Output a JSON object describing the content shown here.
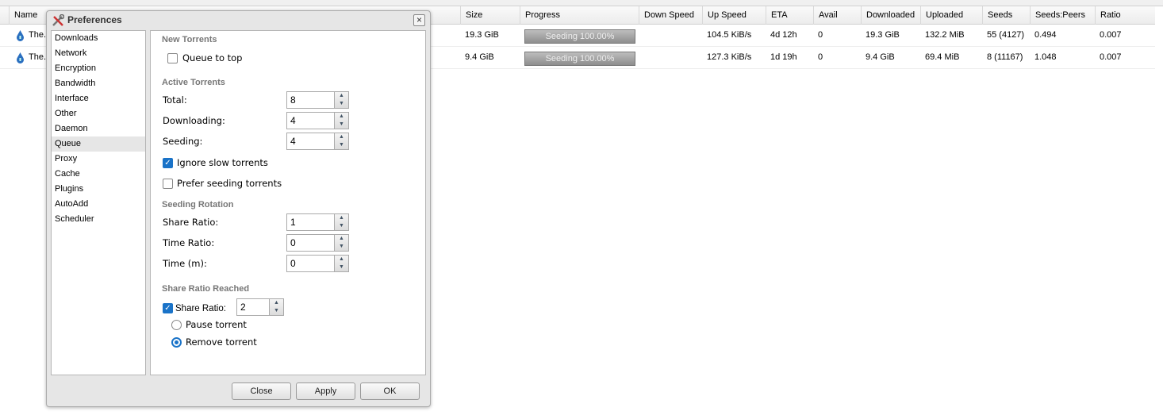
{
  "table": {
    "columns": [
      "Name",
      "Size",
      "Progress",
      "Down Speed",
      "Up Speed",
      "ETA",
      "Avail",
      "Downloaded",
      "Uploaded",
      "Seeds",
      "Seeds:Peers",
      "Ratio"
    ],
    "rows": [
      {
        "name": "The.",
        "size": "19.3 GiB",
        "progress": "Seeding 100.00%",
        "progress_value": 100,
        "down_speed": "",
        "up_speed": "104.5 KiB/s",
        "eta": "4d 12h",
        "avail": "0",
        "downloaded": "19.3 GiB",
        "uploaded": "132.2 MiB",
        "seeds": "55 (4127)",
        "seeds_peers": "0.494",
        "ratio": "0.007"
      },
      {
        "name": "The.",
        "size": "9.4 GiB",
        "progress": "Seeding 100.00%",
        "progress_value": 100,
        "down_speed": "",
        "up_speed": "127.3 KiB/s",
        "eta": "1d 19h",
        "avail": "0",
        "downloaded": "9.4 GiB",
        "uploaded": "69.4 MiB",
        "seeds": "8 (11167)",
        "seeds_peers": "1.048",
        "ratio": "0.007"
      }
    ]
  },
  "dialog": {
    "title": "Preferences",
    "categories": [
      "Downloads",
      "Network",
      "Encryption",
      "Bandwidth",
      "Interface",
      "Other",
      "Daemon",
      "Queue",
      "Proxy",
      "Cache",
      "Plugins",
      "AutoAdd",
      "Scheduler"
    ],
    "selected": "Queue",
    "new_torrents": {
      "heading": "New Torrents",
      "queue_to_top": "Queue to top",
      "queue_to_top_checked": false
    },
    "active": {
      "heading": "Active Torrents",
      "total_label": "Total:",
      "total": "8",
      "downloading_label": "Downloading:",
      "downloading": "4",
      "seeding_label": "Seeding:",
      "seeding": "4",
      "ignore_slow": "Ignore slow torrents",
      "ignore_slow_checked": true,
      "prefer_seeding": "Prefer seeding torrents",
      "prefer_seeding_checked": false
    },
    "rotation": {
      "heading": "Seeding Rotation",
      "share_ratio_label": "Share Ratio:",
      "share_ratio": "1",
      "time_ratio_label": "Time Ratio:",
      "time_ratio": "0",
      "time_label": "Time (m):",
      "time": "0"
    },
    "reached": {
      "heading": "Share Ratio Reached",
      "share_ratio_label": "Share Ratio:",
      "share_ratio_checked": true,
      "share_ratio": "2",
      "pause": "Pause torrent",
      "remove": "Remove torrent",
      "selected_action": "remove"
    },
    "buttons": {
      "close": "Close",
      "apply": "Apply",
      "ok": "OK"
    },
    "accent": "#1a73c8"
  }
}
